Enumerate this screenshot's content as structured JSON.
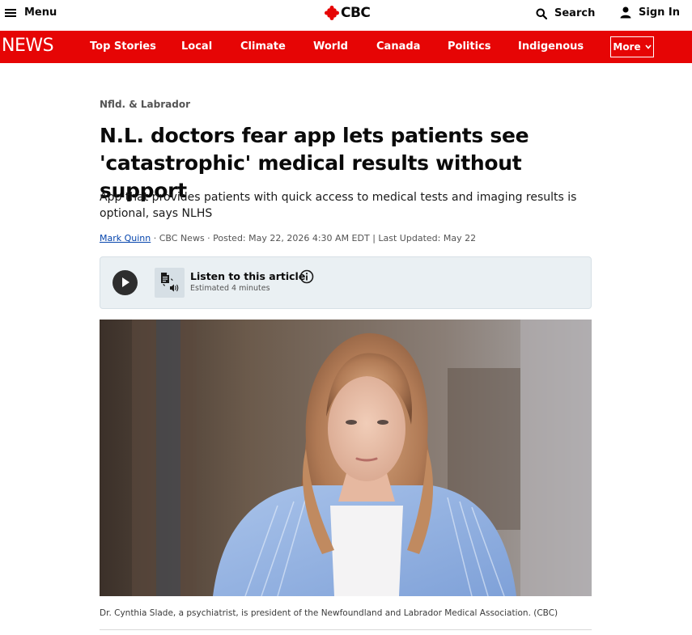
{
  "header": {
    "menu_label": "Menu",
    "logo_text": "CBC",
    "search_label": "Search",
    "signin_label": "Sign In"
  },
  "nav": {
    "brand": "NEWS",
    "items": [
      "Top Stories",
      "Local",
      "Climate",
      "World",
      "Canada",
      "Politics",
      "Indigenous"
    ],
    "more_label": "More"
  },
  "article": {
    "section": "Nfld. & Labrador",
    "headline": "N.L. doctors fear app lets patients see 'catastrophic' medical results without support",
    "deck": "App that provides patients with quick access to medical tests and imaging results is optional, says NLHS",
    "byline": {
      "author": "Mark Quinn",
      "rest": " · CBC News · Posted: May 22, 2026 4:30 AM EDT | Last Updated: May 22"
    },
    "audio": {
      "title": "Listen to this article",
      "estimate": "Estimated 4 minutes"
    },
    "photo_caption": "Dr. Cynthia Slade, a psychiatrist, is president of the Newfoundland and Labrador Medical Association. (CBC)"
  },
  "colors": {
    "brand_red": "#e60505",
    "link_blue": "#0645ad",
    "audio_bg": "#eaf0f3"
  },
  "icons": [
    "menu-icon",
    "cbc-gem-icon",
    "search-icon",
    "user-icon",
    "chevron-down-icon",
    "play-icon",
    "document-audio-icon",
    "info-icon"
  ]
}
